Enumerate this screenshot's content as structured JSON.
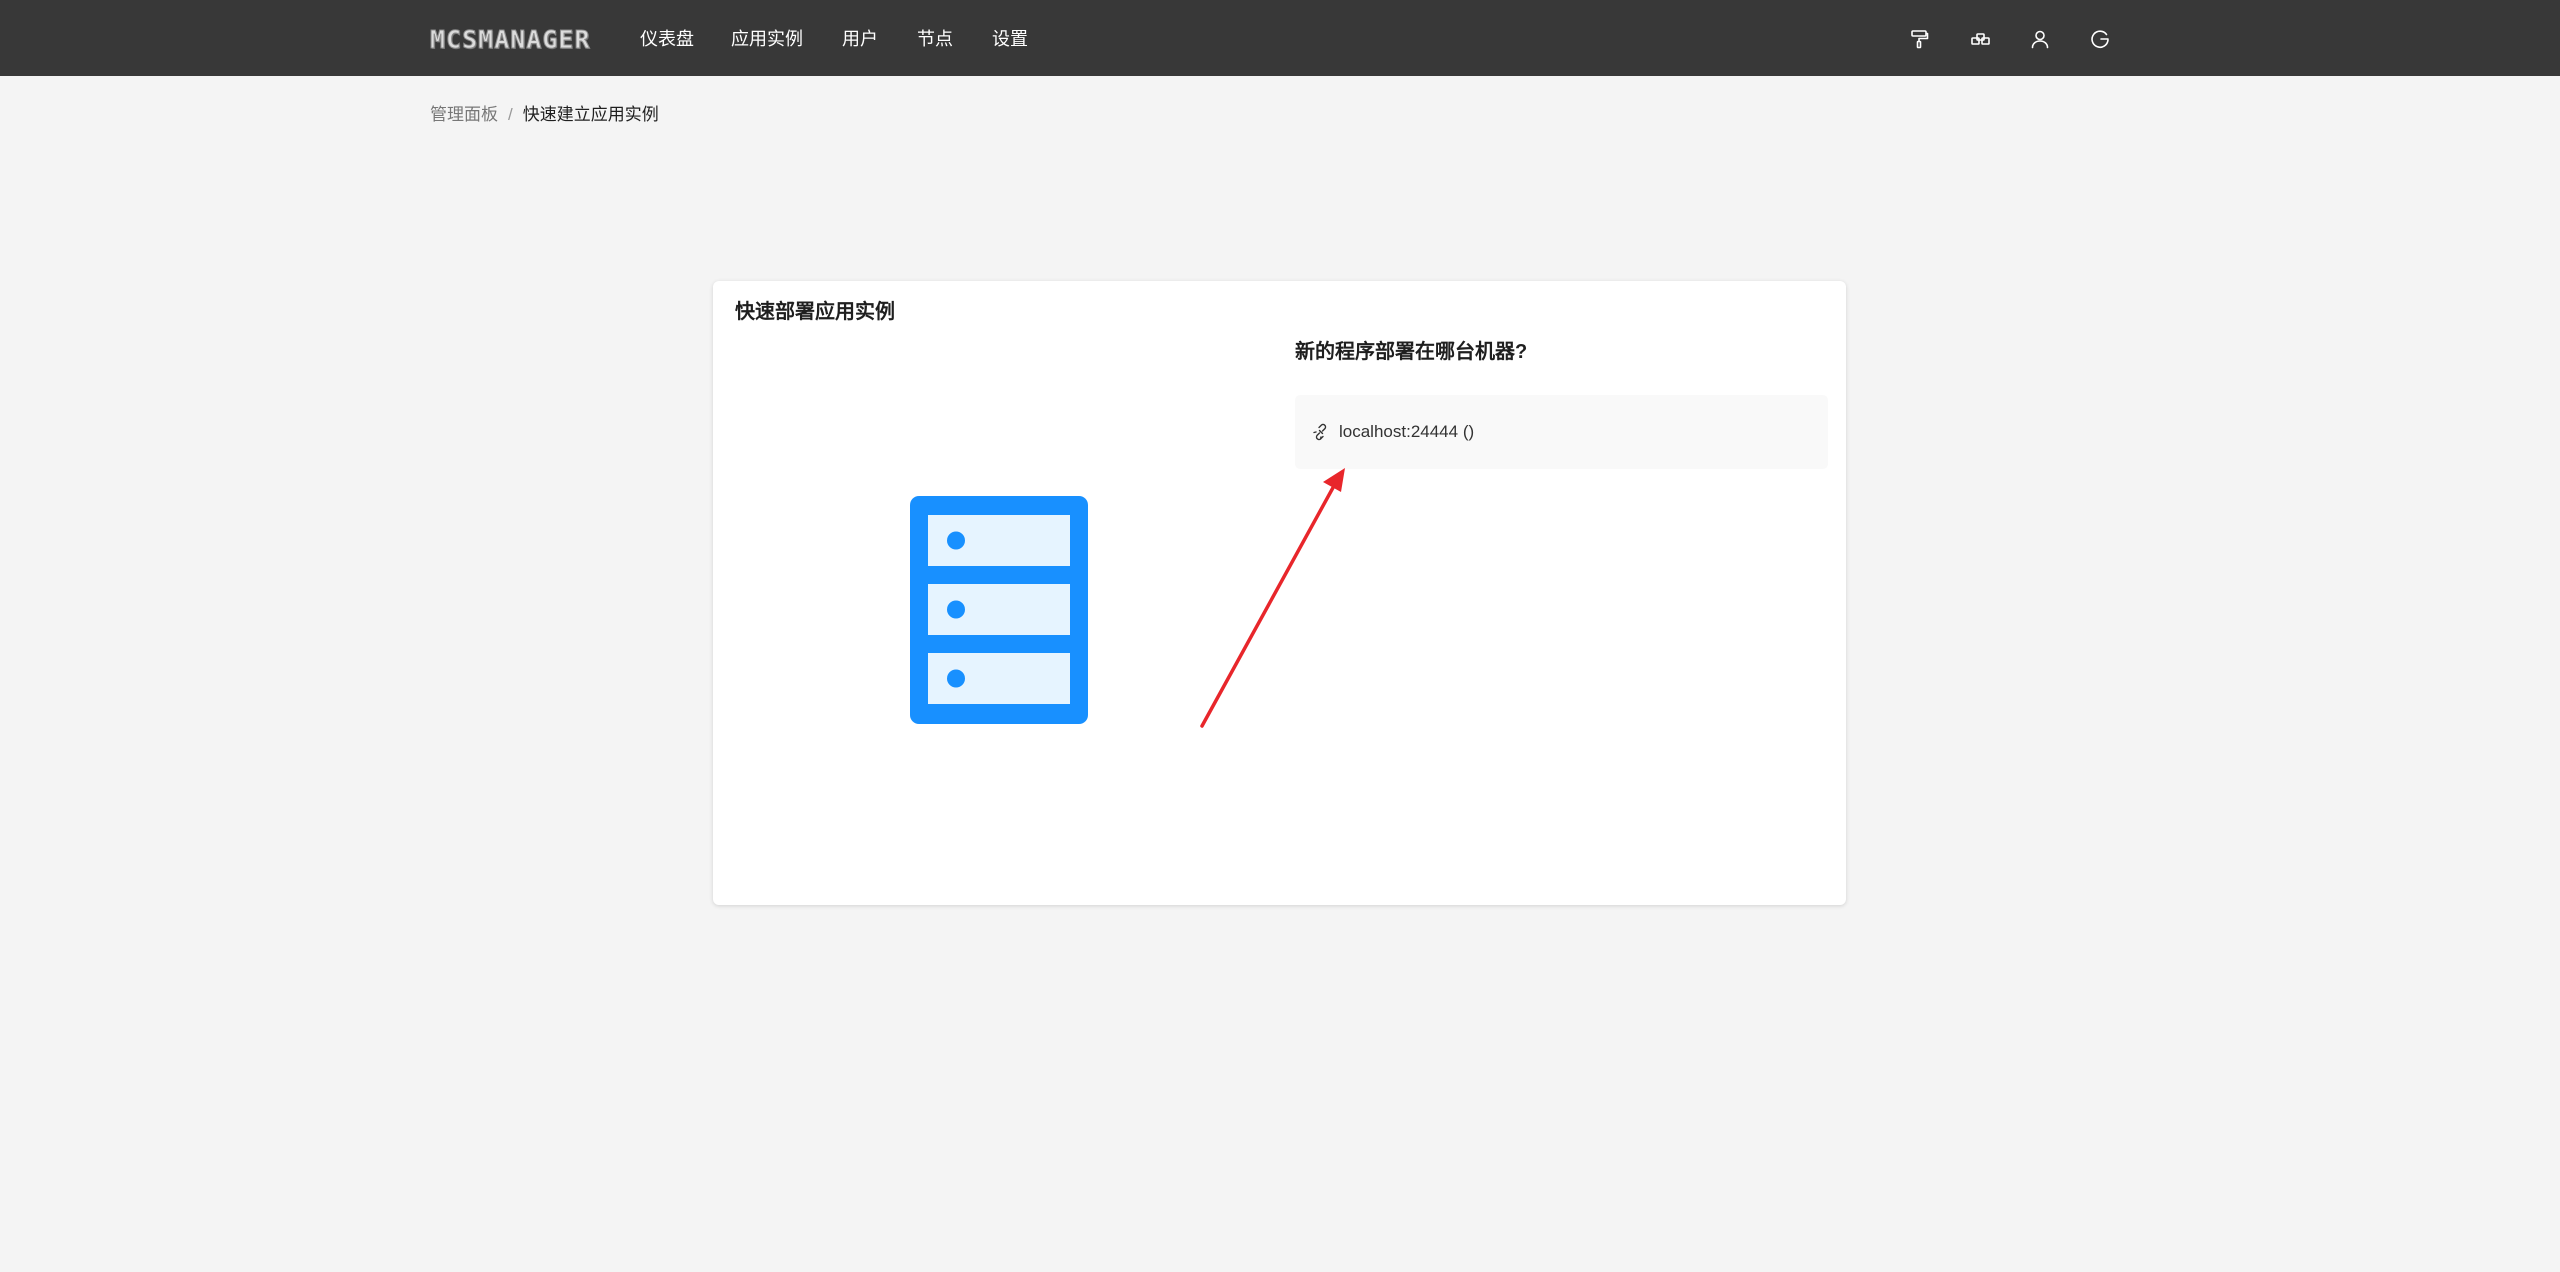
{
  "header": {
    "logo_text": "MCSMANAGER",
    "nav": [
      {
        "label": "仪表盘"
      },
      {
        "label": "应用实例"
      },
      {
        "label": "用户"
      },
      {
        "label": "节点"
      },
      {
        "label": "设置"
      }
    ],
    "tools": [
      "brush-icon",
      "apps-icon",
      "user-icon",
      "logout-icon"
    ]
  },
  "breadcrumb": {
    "home": "管理面板",
    "separator": "/",
    "current": "快速建立应用实例"
  },
  "card": {
    "title": "快速部署应用实例",
    "question": "新的程序部署在哪台机器?",
    "nodes": [
      {
        "label": "localhost:24444 ()",
        "icon": "link-icon"
      }
    ],
    "illustration": "server-rack-icon"
  },
  "colors": {
    "topbar": "#383838",
    "accent": "#1890ff",
    "server_light": "#e6f4ff",
    "arrow": "#e8262b",
    "page_bg": "#f4f4f4"
  }
}
